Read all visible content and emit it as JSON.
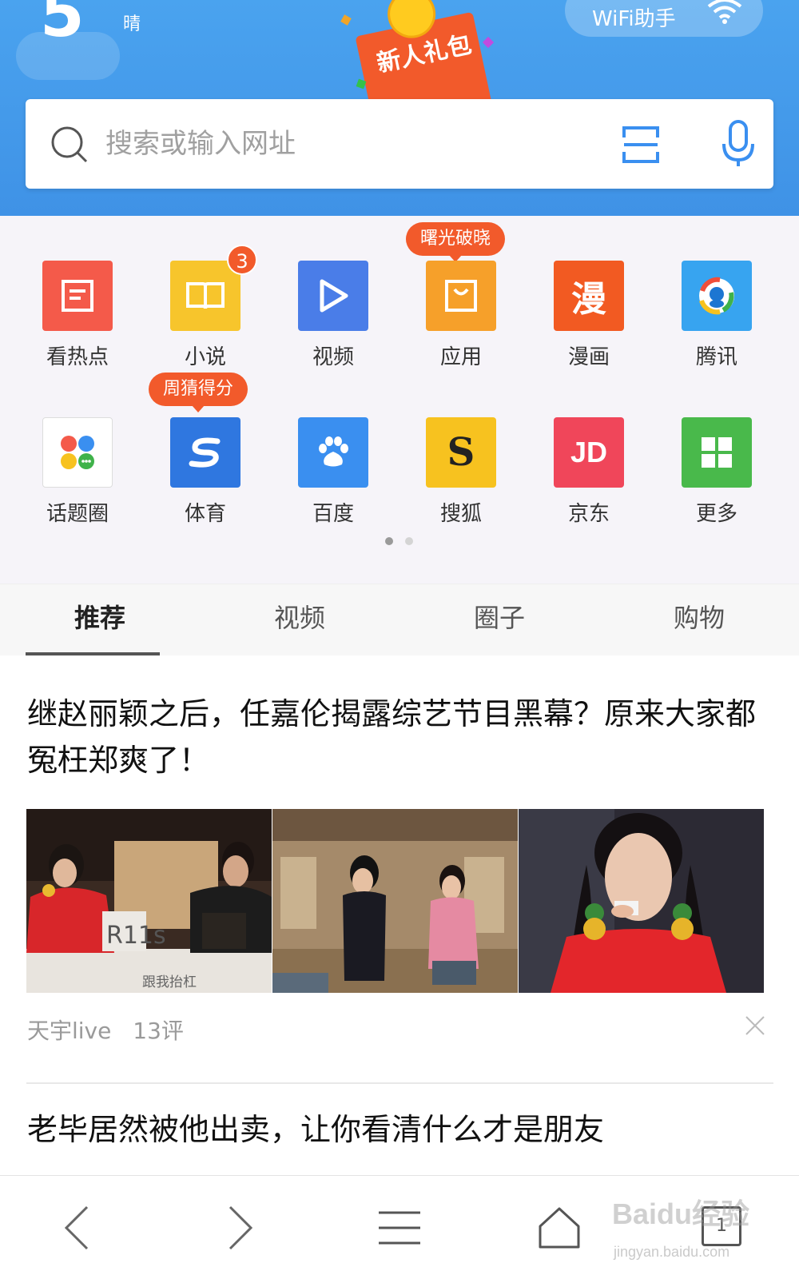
{
  "header": {
    "temperature": "5",
    "weather": "晴",
    "wifi_label": "WiFi助手",
    "gift_label": "新人礼包",
    "accent_color": "#3f92e6"
  },
  "search": {
    "placeholder": "搜索或输入网址",
    "icons": [
      "search-icon",
      "scan-icon",
      "microphone-icon"
    ]
  },
  "shortcuts": {
    "row1": [
      {
        "label": "看热点",
        "color": "#f45a4a",
        "icon": "newspaper-icon"
      },
      {
        "label": "小说",
        "color": "#f7c52c",
        "icon": "book-icon",
        "badge": "3"
      },
      {
        "label": "视频",
        "color": "#4a7de8",
        "icon": "play-icon"
      },
      {
        "label": "应用",
        "color": "#f6a02a",
        "icon": "bag-icon",
        "bubble": "曙光破晓"
      },
      {
        "label": "漫画",
        "color": "#f25a22",
        "icon": "comic-icon",
        "glyph": "漫"
      },
      {
        "label": "腾讯",
        "color": "#37a4f0",
        "icon": "tencent-icon"
      }
    ],
    "row2": [
      {
        "label": "话题圈",
        "color": "#ffffff",
        "icon": "topic-circle-icon"
      },
      {
        "label": "体育",
        "color": "#2f77e0",
        "icon": "sports-icon",
        "bubble": "周猜得分"
      },
      {
        "label": "百度",
        "color": "#3a8ff0",
        "icon": "baidu-paw-icon"
      },
      {
        "label": "搜狐",
        "color": "#f7c21f",
        "icon": "sohu-icon",
        "glyph": "S"
      },
      {
        "label": "京东",
        "color": "#f0465a",
        "icon": "jd-icon",
        "glyph": "JD"
      },
      {
        "label": "更多",
        "color": "#49b94b",
        "icon": "grid-more-icon"
      }
    ],
    "page_dots": 2,
    "active_page": 1
  },
  "tabs": {
    "items": [
      "推荐",
      "视频",
      "圈子",
      "购物"
    ],
    "active": "推荐"
  },
  "feed": {
    "article1": {
      "title": "继赵丽颖之后，任嘉伦揭露综艺节目黑幕？原来大家都冤枉郑爽了！",
      "source": "天宇live",
      "comments": "13评",
      "caption": "跟我抬杠",
      "card_text": "R11s"
    },
    "article2": {
      "title": "老毕居然被他出卖，让你看清什么才是朋友"
    }
  },
  "bottombar": {
    "icons": [
      "back-icon",
      "forward-icon",
      "menu-icon",
      "home-icon",
      "tabs-icon"
    ],
    "tab_count": "1"
  },
  "watermark": {
    "brand": "Baidu经验",
    "url": "jingyan.baidu.com"
  }
}
